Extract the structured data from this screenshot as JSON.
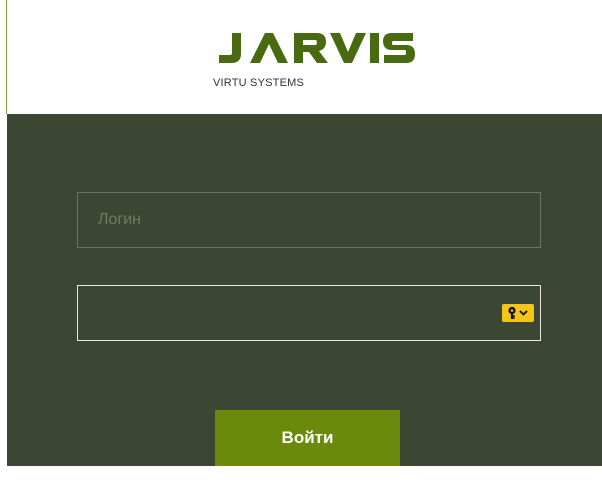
{
  "brand": {
    "name": "JARVIS",
    "subtitle": "VIRTU SYSTEMS",
    "color": "#4a6a12"
  },
  "login": {
    "placeholder": "Логин",
    "value": ""
  },
  "password": {
    "value": "",
    "key_icon": "key-icon"
  },
  "submit": {
    "label": "Войти"
  },
  "colors": {
    "panel": "#3c4733",
    "button": "#6b8a0c",
    "key_button": "#f5c518"
  }
}
